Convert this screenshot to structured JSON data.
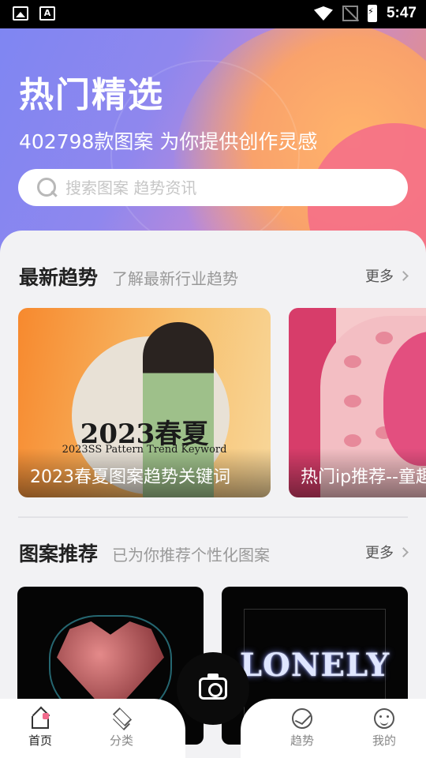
{
  "status_bar": {
    "time": "5:47",
    "icons": [
      "image-icon",
      "font-a-icon",
      "wifi-icon",
      "no-signal-icon",
      "battery-charging-icon"
    ]
  },
  "hero": {
    "title": "热门精选",
    "subtitle": "402798款图案 为你提供创作灵感",
    "search_placeholder": "搜索图案 趋势资讯"
  },
  "trends": {
    "title": "最新趋势",
    "desc": "了解最新行业趋势",
    "more": "更多",
    "cards": [
      {
        "caption": "2023春夏图案趋势关键词",
        "poster_big": "2023春夏",
        "poster_small": "2023SS Pattern Trend Keyword"
      },
      {
        "caption": "热门ip推荐--童趣"
      }
    ]
  },
  "recommend": {
    "title": "图案推荐",
    "desc": "已为你推荐个性化图案",
    "more": "更多",
    "items": [
      {
        "art": "heart"
      },
      {
        "art_text": "LONELY"
      }
    ]
  },
  "nav": {
    "items": [
      {
        "label": "首页",
        "icon": "home-icon",
        "active": true
      },
      {
        "label": "分类",
        "icon": "layers-icon",
        "active": false
      },
      {
        "label": "趋势",
        "icon": "trend-icon",
        "active": false
      },
      {
        "label": "我的",
        "icon": "user-icon",
        "active": false
      }
    ],
    "center_icon": "camera-icon"
  },
  "colors": {
    "accent_pink": "#f16a8c",
    "hero_start": "#7f86f2",
    "hero_end": "#f39068"
  }
}
